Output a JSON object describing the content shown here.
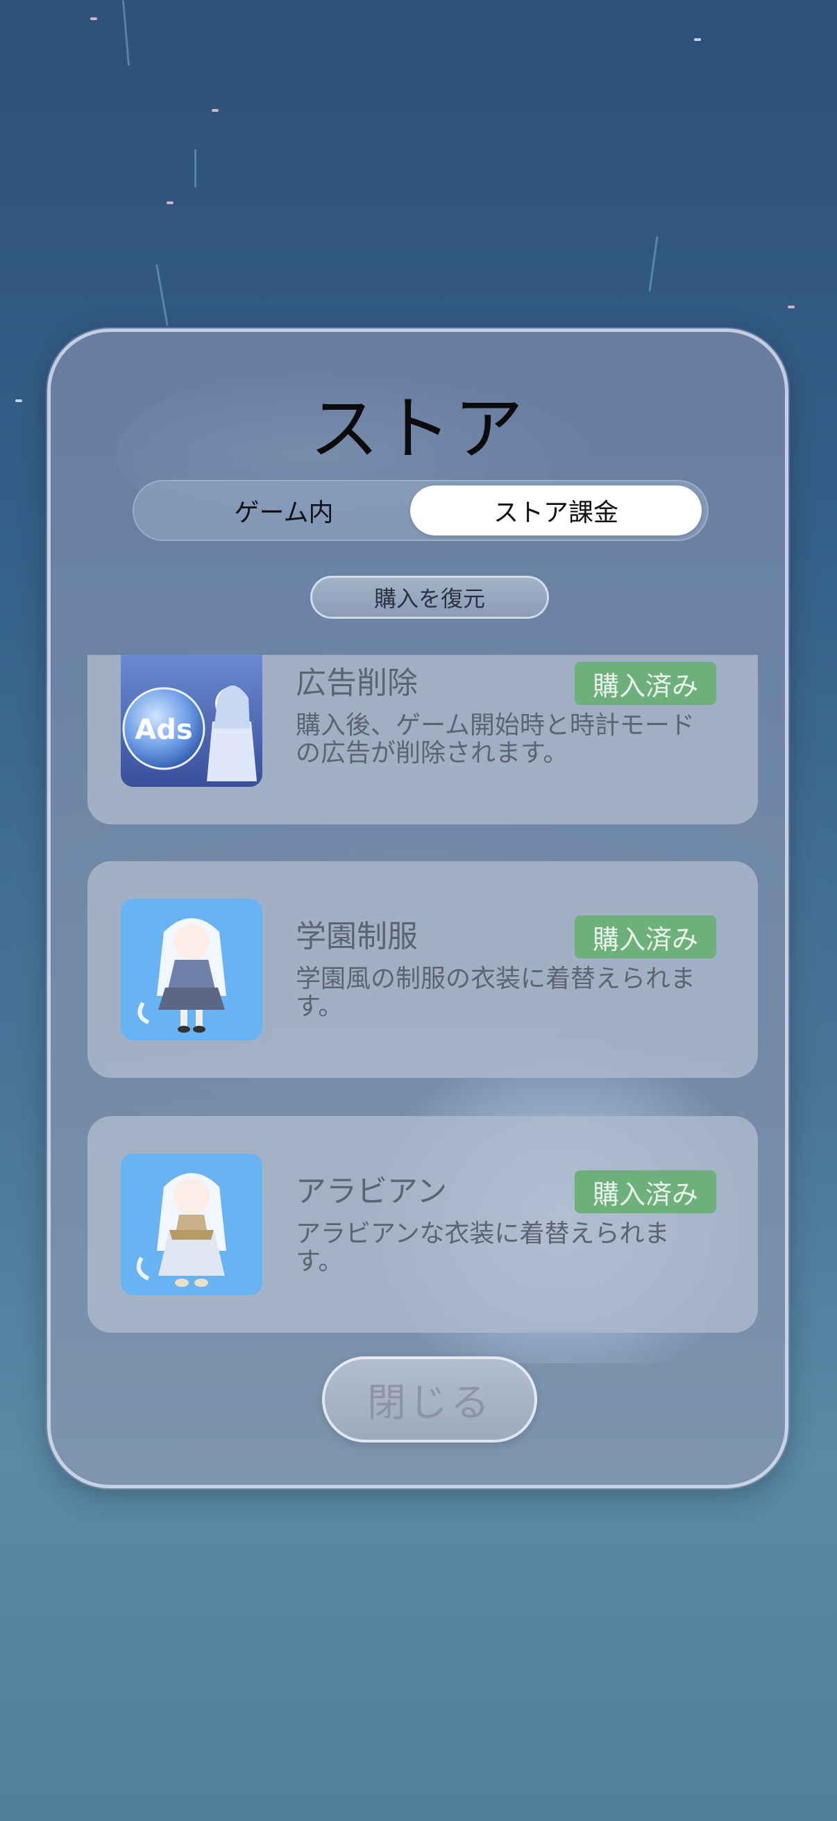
{
  "store": {
    "title": "ストア",
    "tabs": [
      "ゲーム内",
      "ストア課金"
    ],
    "selected_tab": "ストア課金",
    "restore_label": "購入を復元",
    "close_label": "閉じる",
    "items": [
      {
        "name": "広告削除",
        "status": "購入済み",
        "description": "購入後、ゲーム開始時と時計モードの広告が削除されます。",
        "thumbnail_text": "Ads"
      },
      {
        "name": "学園制服",
        "status": "購入済み",
        "description": "学園風の制服の衣装に着替えられます。"
      },
      {
        "name": "アラビアン",
        "status": "購入済み",
        "description": "アラビアンな衣装に着替えられます。"
      }
    ]
  },
  "colors": {
    "badge": "#6db07c",
    "selected_tab": "#ffffff",
    "background": "#35608a"
  }
}
